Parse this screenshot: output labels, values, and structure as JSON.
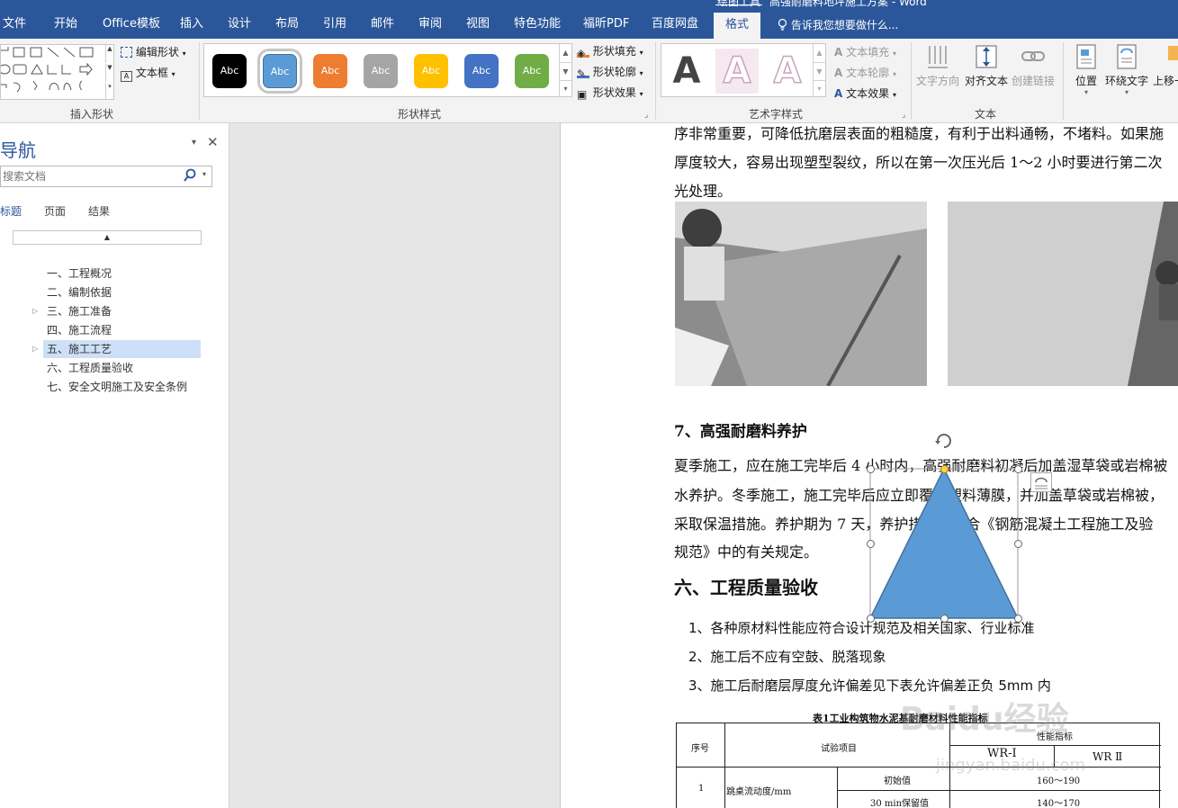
{
  "window": {
    "contextual_tab_group": "绘图工具",
    "document_title_fragment": "高强耐磨料地坪施工方案 - Word"
  },
  "ribbon_tabs": [
    {
      "label": "文件"
    },
    {
      "label": "开始"
    },
    {
      "label": "Office模板"
    },
    {
      "label": "插入"
    },
    {
      "label": "设计"
    },
    {
      "label": "布局"
    },
    {
      "label": "引用"
    },
    {
      "label": "邮件"
    },
    {
      "label": "审阅"
    },
    {
      "label": "视图"
    },
    {
      "label": "特色功能"
    },
    {
      "label": "福昕PDF"
    },
    {
      "label": "百度网盘"
    },
    {
      "label": "格式"
    }
  ],
  "tell_me": "告诉我您想要做什么...",
  "ribbon": {
    "insert_shapes": {
      "label": "插入形状",
      "edit_shape": "编辑形状",
      "text_box": "文本框"
    },
    "shape_styles": {
      "label": "形状样式",
      "swatch_text": "Abc",
      "swatches": [
        {
          "color": "#000000"
        },
        {
          "color": "#5b9bd5"
        },
        {
          "color": "#ed7d31"
        },
        {
          "color": "#a5a5a5"
        },
        {
          "color": "#ffc000"
        },
        {
          "color": "#4472c4"
        },
        {
          "color": "#70ad47"
        }
      ],
      "fill": "形状填充",
      "outline": "形状轮廓",
      "effects": "形状效果"
    },
    "wordart_styles": {
      "label": "艺术字样式",
      "letter": "A",
      "text_fill": "文本填充",
      "text_outline": "文本轮廓",
      "text_effects": "文本效果"
    },
    "text_group": {
      "label": "文本",
      "text_direction": "文字方向",
      "align_text": "对齐文本",
      "create_link": "创建链接"
    },
    "arrange": {
      "position": "位置",
      "wrap_text": "环绕文字",
      "bring_forward": "上移一层"
    }
  },
  "nav_pane": {
    "title": "导航",
    "search_placeholder": "搜索文档",
    "tabs": [
      {
        "label": "标题"
      },
      {
        "label": "页面"
      },
      {
        "label": "结果"
      }
    ],
    "headings": [
      {
        "label": "一、工程概况",
        "has_children": false,
        "selected": false
      },
      {
        "label": "二、编制依据",
        "has_children": false,
        "selected": false
      },
      {
        "label": "三、施工准备",
        "has_children": true,
        "selected": false
      },
      {
        "label": "四、施工流程",
        "has_children": false,
        "selected": false
      },
      {
        "label": "五、施工工艺",
        "has_children": true,
        "selected": true
      },
      {
        "label": "六、工程质量验收",
        "has_children": false,
        "selected": false
      },
      {
        "label": "七、安全文明施工及安全条例",
        "has_children": false,
        "selected": false
      }
    ]
  },
  "document": {
    "para_top": [
      "序非常重要，可降低抗磨层表面的粗糙度，有利于出料通畅，不堵料。如果施",
      "厚度较大，容易出现塑型裂纹，所以在第一次压光后 1～2 小时要进行第二次",
      "光处理。"
    ],
    "heading_7": "7、高强耐磨料养护",
    "para_curing": [
      "夏季施工，应在施工完毕后 4 小时内，高强耐磨料初凝后加盖湿草袋或岩棉被",
      "水养护。冬季施工，施工完毕后应立即覆盖塑料薄膜，并加盖草袋或岩棉被，",
      "采取保温措施。养护期为 7 天，养护措施应符合《钢筋混凝土工程施工及验",
      "规范》中的有关规定。"
    ],
    "heading_6": "六、工程质量验收",
    "list": [
      "1、各种原材料性能应符合设计规范及相关国家、行业标准",
      "2、施工后不应有空鼓、脱落现象",
      "3、施工后耐磨层厚度允许偏差见下表允许偏差正负 5mm 内"
    ],
    "table": {
      "title": "表1工业构筑物水泥基耐磨材料性能指标",
      "col_seq": "序号",
      "col_item": "试验项目",
      "col_index": "性能指标",
      "col_wr1": "WR-Ⅰ",
      "col_wr2": "WR Ⅱ",
      "row1_seq": "1",
      "row1_item": "跳桌流动度/mm",
      "row1_sub1": "初始值",
      "row1_sub1_val": "160～190",
      "row1_sub2": "30 min保留值",
      "row1_sub2_val": "140～170"
    },
    "shape": {
      "type": "isosceles-triangle",
      "fill": "#5b9bd5",
      "outline": "#41719c"
    },
    "watermark": {
      "logo": "Baidu经验",
      "url": "jingyan.baidu.com"
    }
  }
}
